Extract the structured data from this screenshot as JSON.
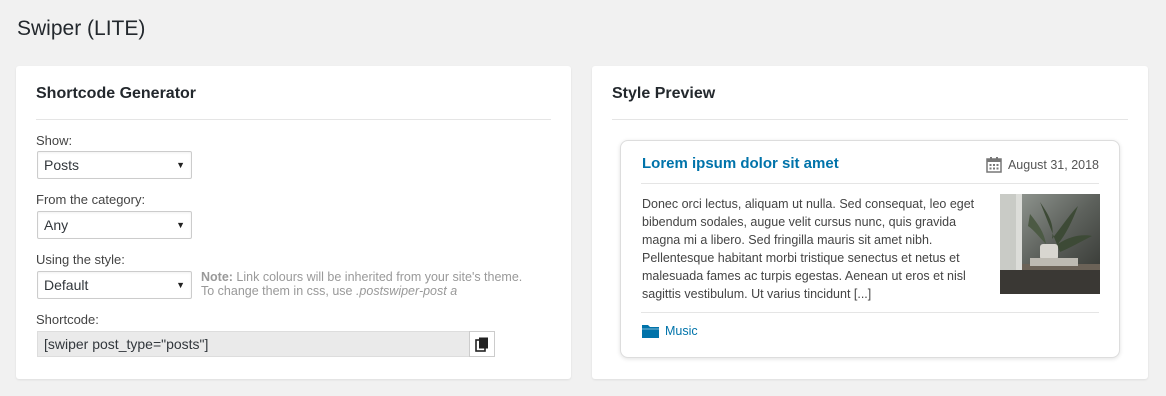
{
  "page": {
    "title": "Swiper (LITE)"
  },
  "generator": {
    "title": "Shortcode Generator",
    "show_label": "Show:",
    "show_value": "Posts",
    "category_label": "From the category:",
    "category_value": "Any",
    "style_label": "Using the style:",
    "style_value": "Default",
    "note_bold": "Note:",
    "note_line1": " Link colours will be inherited from your site's theme.",
    "note_line2_prefix": "To change them in css, use ",
    "note_code": ".postswiper-post a",
    "shortcode_label": "Shortcode:",
    "shortcode_value": "[swiper post_type=\"posts\"]"
  },
  "preview": {
    "title": "Style Preview",
    "card_title": "Lorem ipsum dolor sit amet",
    "card_date": "August 31, 2018",
    "card_excerpt": "Donec orci lectus, aliquam ut nulla. Sed consequat, leo eget bibendum sodales, augue velit cursus nunc, quis gravida magna mi a libero. Sed fringilla mauris sit amet nibh. Pellentesque habitant morbi tristique senectus et netus et malesuada fames ac turpis egestas. Aenean ut eros et nisl sagittis vestibulum. Ut varius tincidunt [...]",
    "card_category": "Music"
  },
  "colors": {
    "link": "#0073aa",
    "background": "#f1f1f1"
  },
  "icons": {
    "date": "calendar-icon",
    "category": "folder-icon",
    "copy": "copy-icon"
  }
}
